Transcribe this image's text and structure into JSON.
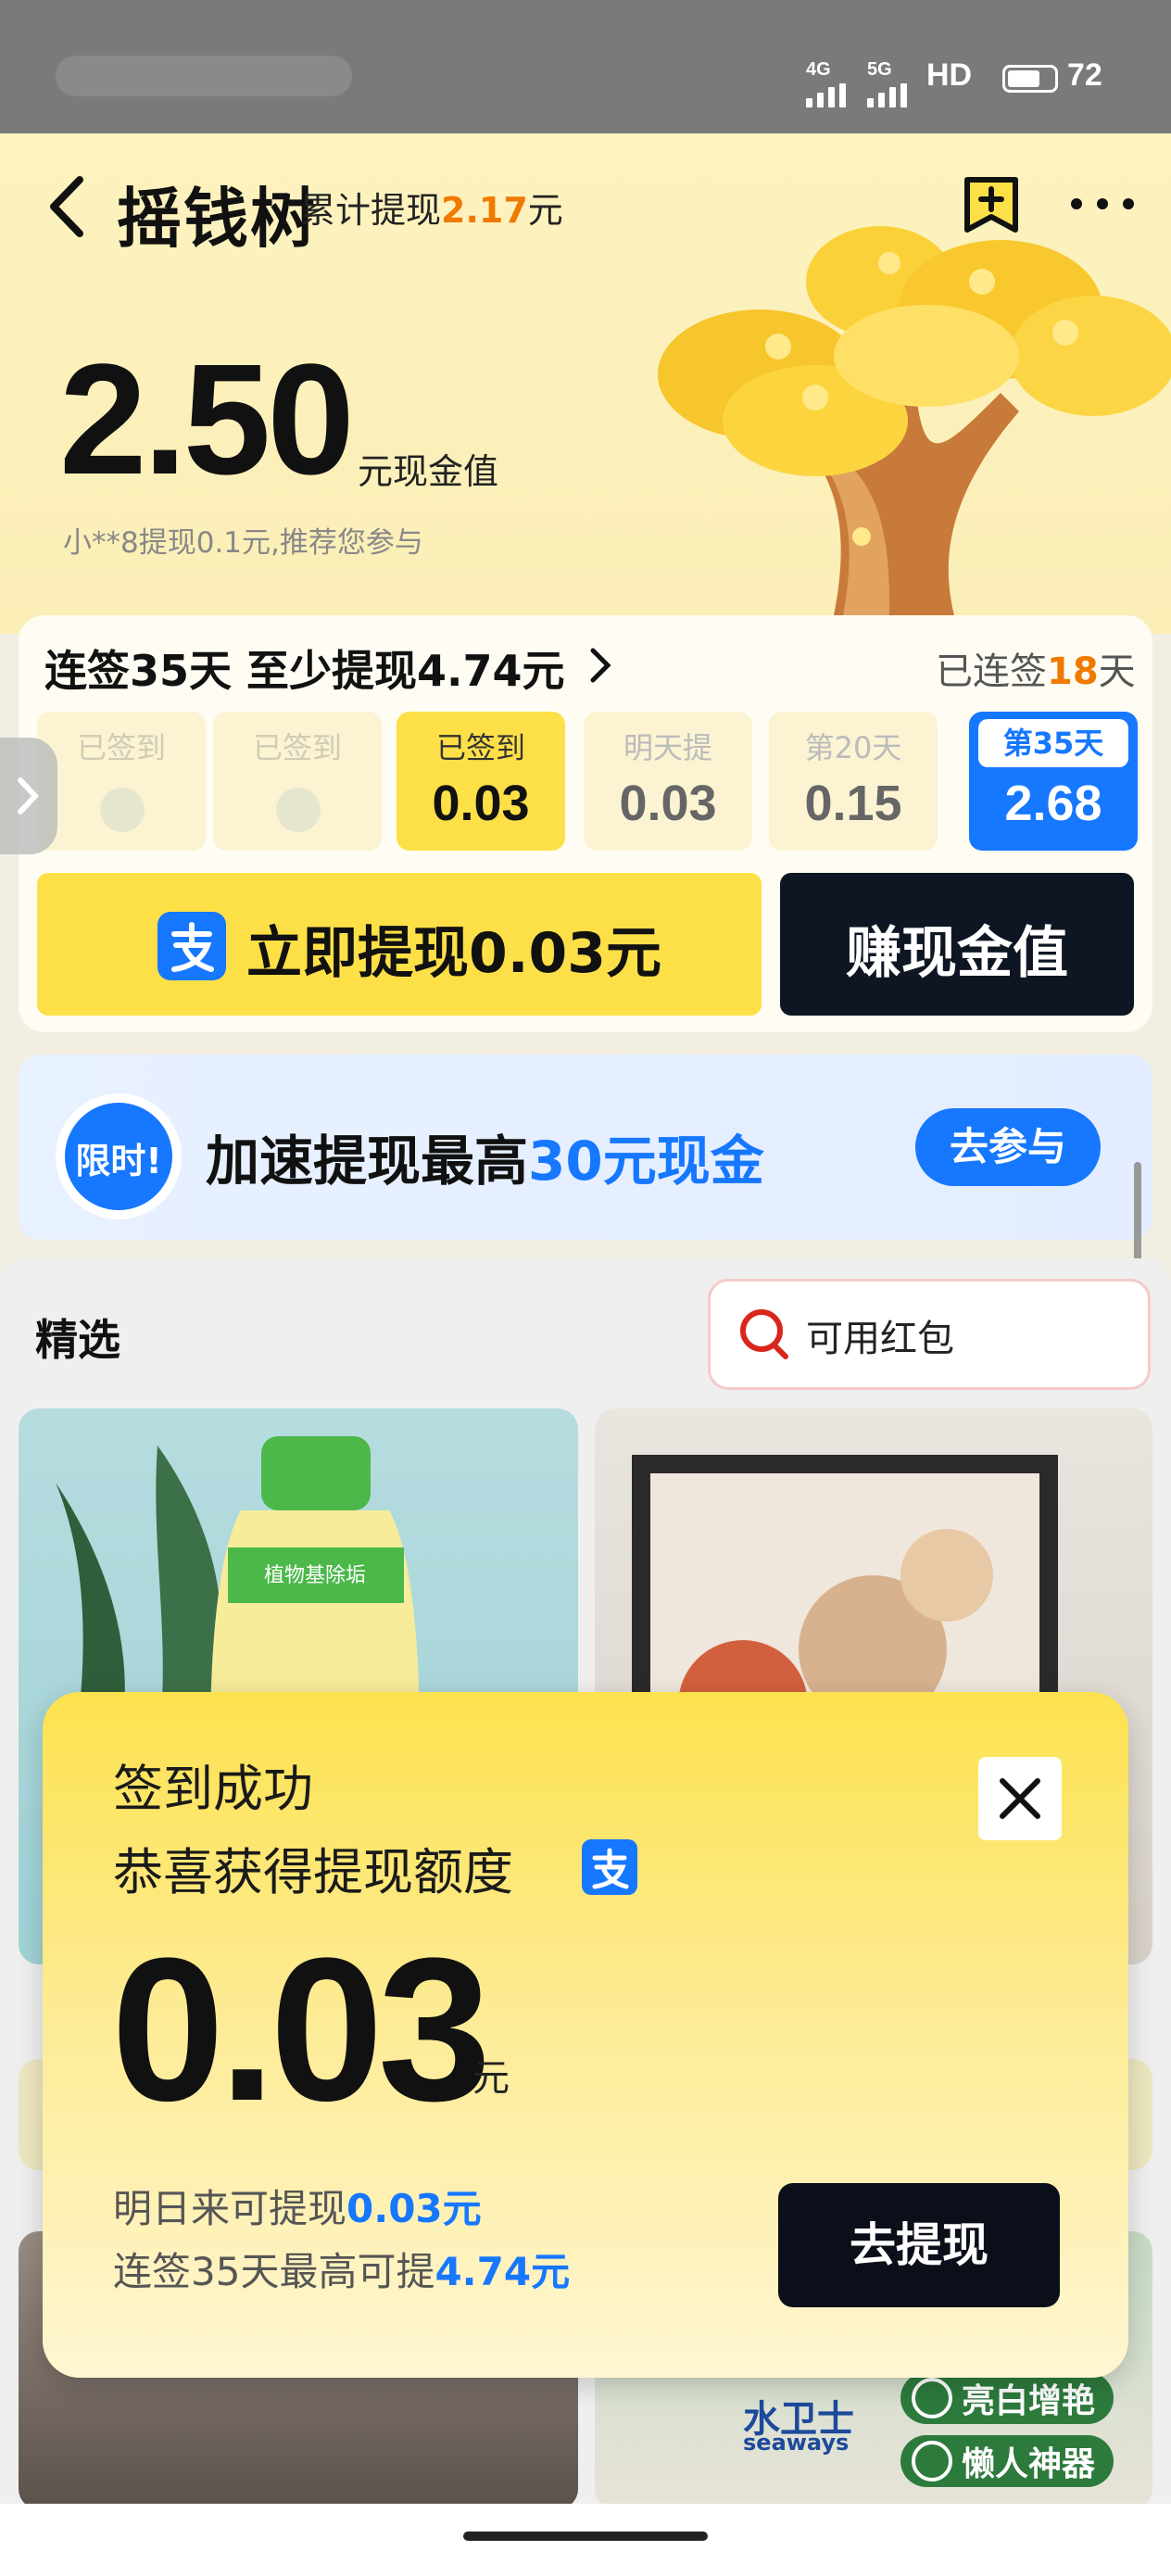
{
  "status_bar": {
    "net1": "4G",
    "net2": "5G",
    "hd": "HD",
    "battery": "72"
  },
  "header": {
    "title": "摇钱树",
    "cumulative_label": "累计提现",
    "cumulative_value": "2.17",
    "cumulative_unit": "元"
  },
  "balance": {
    "value": "2.50",
    "unit": "元现金值",
    "tip": "小**8提现0.1元,推荐您参与"
  },
  "signin": {
    "title": "连签35天 至少提现4.74元",
    "streak_prefix": "已连签",
    "streak_days": "18",
    "streak_suffix": "天",
    "days": [
      {
        "label": "已签到",
        "value": "",
        "state": "done"
      },
      {
        "label": "已签到",
        "value": "",
        "state": "done"
      },
      {
        "label": "已签到",
        "value": "0.03",
        "state": "today"
      },
      {
        "label": "明天提",
        "value": "0.03",
        "state": "future"
      },
      {
        "label": "第20天",
        "value": "0.15",
        "state": "future"
      },
      {
        "label": "第35天",
        "value": "2.68",
        "state": "target"
      }
    ],
    "withdraw_label": "立即提现0.03元",
    "earn_label": "赚现金值"
  },
  "promo": {
    "badge": "限时!",
    "text_a": "加速提现最高",
    "text_b": "30元现金",
    "button": "去参与"
  },
  "feed": {
    "title": "精选",
    "search_label": "可用红包",
    "product1_bottle_label": "植物基除垢",
    "product6_tags": [
      "亮白增艳",
      "懒人神器"
    ],
    "product6_brand": "水卫士",
    "product6_brand_en": "seaways"
  },
  "dialog": {
    "title": "签到成功",
    "subtitle": "恭喜获得提现额度",
    "amount": "0.03",
    "amount_unit": "元",
    "line1_a": "明日来可提现",
    "line1_b": "0.03元",
    "line2_a": "连签35天最高可提",
    "line2_b": "4.74元",
    "button": "去提现"
  },
  "colors": {
    "accent_yellow": "#fde047",
    "accent_blue": "#1677ff",
    "accent_orange": "#f07a00",
    "dark": "#0f1623"
  }
}
